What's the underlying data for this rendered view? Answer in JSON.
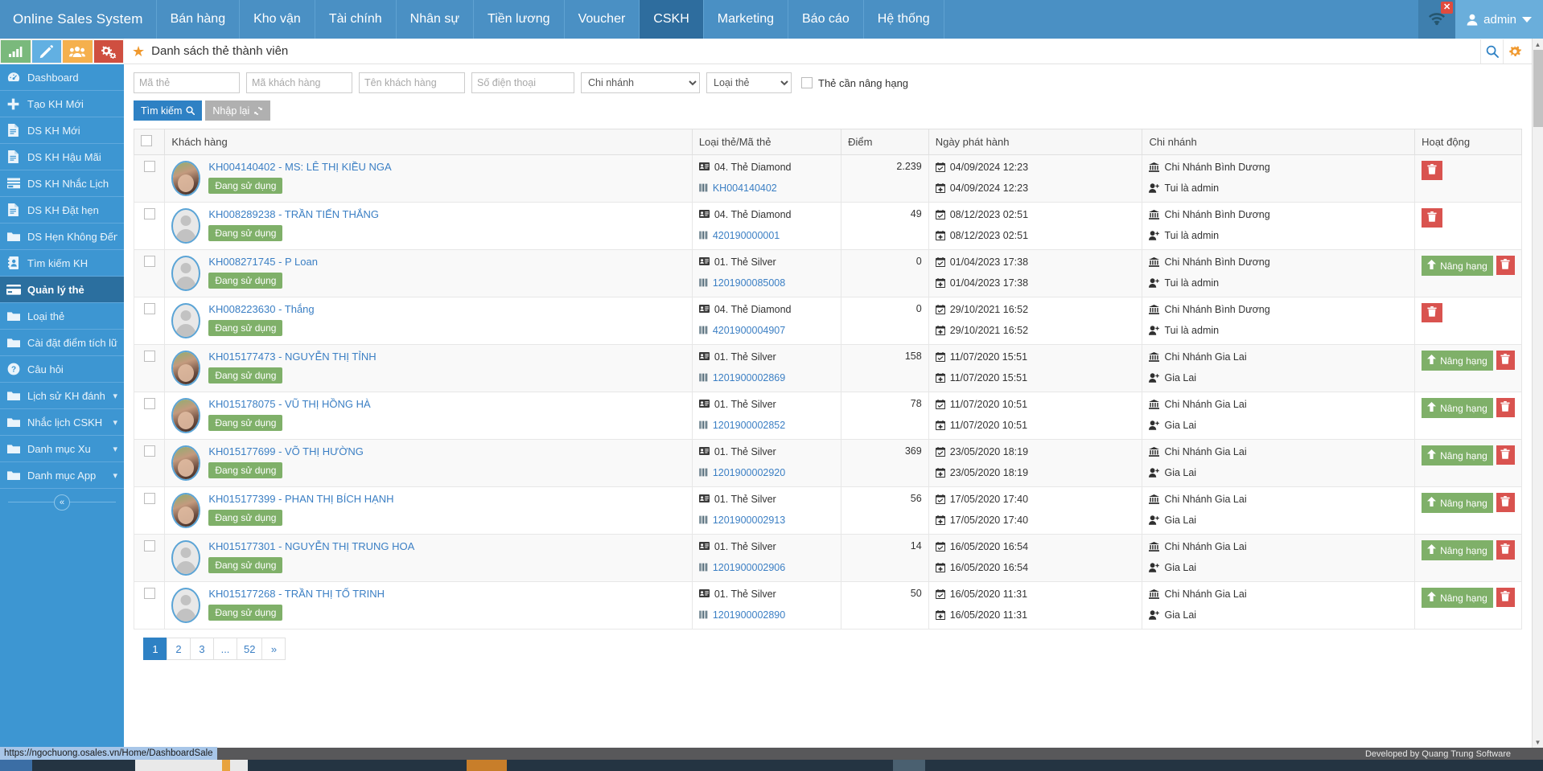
{
  "topnav": {
    "brand": "Online Sales System",
    "items": [
      {
        "label": "Bán hàng",
        "active": false
      },
      {
        "label": "Kho vận",
        "active": false
      },
      {
        "label": "Tài chính",
        "active": false
      },
      {
        "label": "Nhân sự",
        "active": false
      },
      {
        "label": "Tiền lương",
        "active": false
      },
      {
        "label": "Voucher",
        "active": false
      },
      {
        "label": "CSKH",
        "active": true
      },
      {
        "label": "Marketing",
        "active": false
      },
      {
        "label": "Báo cáo",
        "active": false
      },
      {
        "label": "Hệ thống",
        "active": false
      }
    ],
    "wifi_badge": "✕",
    "user": "admin"
  },
  "sidebar": {
    "toolbar": [
      {
        "icon": "chart-bar-icon",
        "color": "#7ab97c"
      },
      {
        "icon": "pencil-icon",
        "color": "#62b0e2"
      },
      {
        "icon": "users-icon",
        "color": "#f5b04d"
      },
      {
        "icon": "gears-icon",
        "color": "#cf4f40"
      }
    ],
    "items": [
      {
        "label": "Dashboard",
        "icon": "dashboard-icon",
        "active": false,
        "chevron": false
      },
      {
        "label": "Tạo KH Mới",
        "icon": "plus-icon",
        "active": false,
        "chevron": false
      },
      {
        "label": "DS KH Mới",
        "icon": "file-icon",
        "active": false,
        "chevron": false
      },
      {
        "label": "DS KH Hậu Mãi",
        "icon": "file-icon",
        "active": false,
        "chevron": false
      },
      {
        "label": "DS KH Nhắc Lịch",
        "icon": "list-icon",
        "active": false,
        "chevron": false
      },
      {
        "label": "DS KH Đặt hẹn",
        "icon": "file-icon",
        "active": false,
        "chevron": false
      },
      {
        "label": "DS Hẹn Không Đến",
        "icon": "folder-icon",
        "active": false,
        "chevron": false
      },
      {
        "label": "Tìm kiếm KH",
        "icon": "address-book-icon",
        "active": false,
        "chevron": false
      },
      {
        "label": "Quản lý thẻ",
        "icon": "card-icon",
        "active": true,
        "chevron": false
      },
      {
        "label": "Loại thẻ",
        "icon": "folder-icon",
        "active": false,
        "chevron": false
      },
      {
        "label": "Cài đặt điểm tích lũy",
        "icon": "folder-icon",
        "active": false,
        "chevron": false
      },
      {
        "label": "Câu hỏi",
        "icon": "question-circle-icon",
        "active": false,
        "chevron": false
      },
      {
        "label": "Lịch sử KH đánh giá",
        "icon": "folder-icon",
        "active": false,
        "chevron": true
      },
      {
        "label": "Nhắc lịch CSKH",
        "icon": "folder-icon",
        "active": false,
        "chevron": true
      },
      {
        "label": "Danh mục Xu",
        "icon": "folder-icon",
        "active": false,
        "chevron": true
      },
      {
        "label": "Danh mục App",
        "icon": "folder-icon",
        "active": false,
        "chevron": true
      }
    ],
    "collapse_label": "«"
  },
  "panel": {
    "title": "Danh sách thẻ thành viên",
    "star_icon": "star-icon",
    "search_icon": "search-icon",
    "gear_icon": "gear-icon"
  },
  "filters": {
    "card_code": {
      "value": "",
      "placeholder": "Mã thẻ"
    },
    "customer_code": {
      "value": "",
      "placeholder": "Mã khách hàng"
    },
    "customer_name": {
      "value": "",
      "placeholder": "Tên khách hàng"
    },
    "phone": {
      "value": "",
      "placeholder": "Số điện thoại"
    },
    "branch": {
      "selected": "Chi nhánh",
      "options": [
        "Chi nhánh"
      ]
    },
    "card_type": {
      "selected": "Loại thẻ",
      "options": [
        "Loại thẻ"
      ]
    },
    "upgrade_checkbox_label": "Thẻ cần nâng hạng",
    "search_button": "Tìm kiếm",
    "reset_button": "Nhập lại"
  },
  "table": {
    "headers": [
      "Khách hàng",
      "Loại thẻ/Mã thẻ",
      "Điểm",
      "Ngày phát hành",
      "Chi nhánh",
      "Hoạt động"
    ],
    "status_label": "Đang sử dụng",
    "upgrade_label": "Nâng hạng",
    "rows": [
      {
        "name": "KH004140402 - MS: LÊ THỊ KIỀU NGA",
        "avatar": "photo",
        "status": "Đang sử dụng",
        "card_type": "04. Thẻ Diamond",
        "card_code": "KH004140402",
        "points": "2.239",
        "date_issued": "04/09/2024 12:23",
        "date_updated": "04/09/2024 12:23",
        "branch": "Chi Nhánh Bình Dương",
        "creator": "Tui là admin",
        "can_upgrade": false
      },
      {
        "name": "KH008289238 - TRẦN TIẾN THẮNG",
        "avatar": "blank",
        "status": "Đang sử dụng",
        "card_type": "04. Thẻ Diamond",
        "card_code": "420190000001",
        "points": "49",
        "date_issued": "08/12/2023 02:51",
        "date_updated": "08/12/2023 02:51",
        "branch": "Chi Nhánh Bình Dương",
        "creator": "Tui là admin",
        "can_upgrade": false
      },
      {
        "name": "KH008271745 - P Loan",
        "avatar": "blank",
        "status": "Đang sử dụng",
        "card_type": "01. Thẻ Silver",
        "card_code": "1201900085008",
        "points": "0",
        "date_issued": "01/04/2023 17:38",
        "date_updated": "01/04/2023 17:38",
        "branch": "Chi Nhánh Bình Dương",
        "creator": "Tui là admin",
        "can_upgrade": true
      },
      {
        "name": "KH008223630 - Thắng",
        "avatar": "blank",
        "status": "Đang sử dụng",
        "card_type": "04. Thẻ Diamond",
        "card_code": "4201900004907",
        "points": "0",
        "date_issued": "29/10/2021 16:52",
        "date_updated": "29/10/2021 16:52",
        "branch": "Chi Nhánh Bình Dương",
        "creator": "Tui là admin",
        "can_upgrade": false
      },
      {
        "name": "KH015177473 - NGUYỄN THỊ TỈNH",
        "avatar": "photo",
        "status": "Đang sử dụng",
        "card_type": "01. Thẻ Silver",
        "card_code": "1201900002869",
        "points": "158",
        "date_issued": "11/07/2020 15:51",
        "date_updated": "11/07/2020 15:51",
        "branch": "Chi Nhánh Gia Lai",
        "creator": "Gia Lai",
        "can_upgrade": true
      },
      {
        "name": "KH015178075 - VŨ THỊ HỒNG HÀ",
        "avatar": "photo",
        "status": "Đang sử dụng",
        "card_type": "01. Thẻ Silver",
        "card_code": "1201900002852",
        "points": "78",
        "date_issued": "11/07/2020 10:51",
        "date_updated": "11/07/2020 10:51",
        "branch": "Chi Nhánh Gia Lai",
        "creator": "Gia Lai",
        "can_upgrade": true
      },
      {
        "name": "KH015177699 - VÕ THỊ HƯỜNG",
        "avatar": "photo",
        "status": "Đang sử dụng",
        "card_type": "01. Thẻ Silver",
        "card_code": "1201900002920",
        "points": "369",
        "date_issued": "23/05/2020 18:19",
        "date_updated": "23/05/2020 18:19",
        "branch": "Chi Nhánh Gia Lai",
        "creator": "Gia Lai",
        "can_upgrade": true
      },
      {
        "name": "KH015177399 - PHAN THỊ BÍCH HẠNH",
        "avatar": "photo",
        "status": "Đang sử dụng",
        "card_type": "01. Thẻ Silver",
        "card_code": "1201900002913",
        "points": "56",
        "date_issued": "17/05/2020 17:40",
        "date_updated": "17/05/2020 17:40",
        "branch": "Chi Nhánh Gia Lai",
        "creator": "Gia Lai",
        "can_upgrade": true
      },
      {
        "name": "KH015177301 - NGUYỄN THỊ TRUNG HOA",
        "avatar": "blank",
        "status": "Đang sử dụng",
        "card_type": "01. Thẻ Silver",
        "card_code": "1201900002906",
        "points": "14",
        "date_issued": "16/05/2020 16:54",
        "date_updated": "16/05/2020 16:54",
        "branch": "Chi Nhánh Gia Lai",
        "creator": "Gia Lai",
        "can_upgrade": true
      },
      {
        "name": "KH015177268 - TRẦN THỊ TỐ TRINH",
        "avatar": "blank",
        "status": "Đang sử dụng",
        "card_type": "01. Thẻ Silver",
        "card_code": "1201900002890",
        "points": "50",
        "date_issued": "16/05/2020 11:31",
        "date_updated": "16/05/2020 11:31",
        "branch": "Chi Nhánh Gia Lai",
        "creator": "Gia Lai",
        "can_upgrade": true
      }
    ]
  },
  "pagination": {
    "pages": [
      {
        "label": "1",
        "active": true
      },
      {
        "label": "2",
        "active": false
      },
      {
        "label": "3",
        "active": false
      },
      {
        "label": "...",
        "active": false
      },
      {
        "label": "52",
        "active": false
      },
      {
        "label": "»",
        "active": false
      }
    ]
  },
  "status_bar": {
    "url": "https://ngochuong.osales.vn/Home/DashboardSale"
  },
  "footer": {
    "text": "Developed by Quang Trung Software"
  },
  "colors": {
    "nav_blue": "#4a90c4",
    "nav_active": "#2e6d9e",
    "sidebar_blue": "#3d96d2",
    "sidebar_active": "#2b6f9f",
    "accent_green": "#7fb069",
    "accent_red": "#d9534f",
    "link_blue": "#3b7fc4",
    "star_orange": "#f0992e"
  }
}
